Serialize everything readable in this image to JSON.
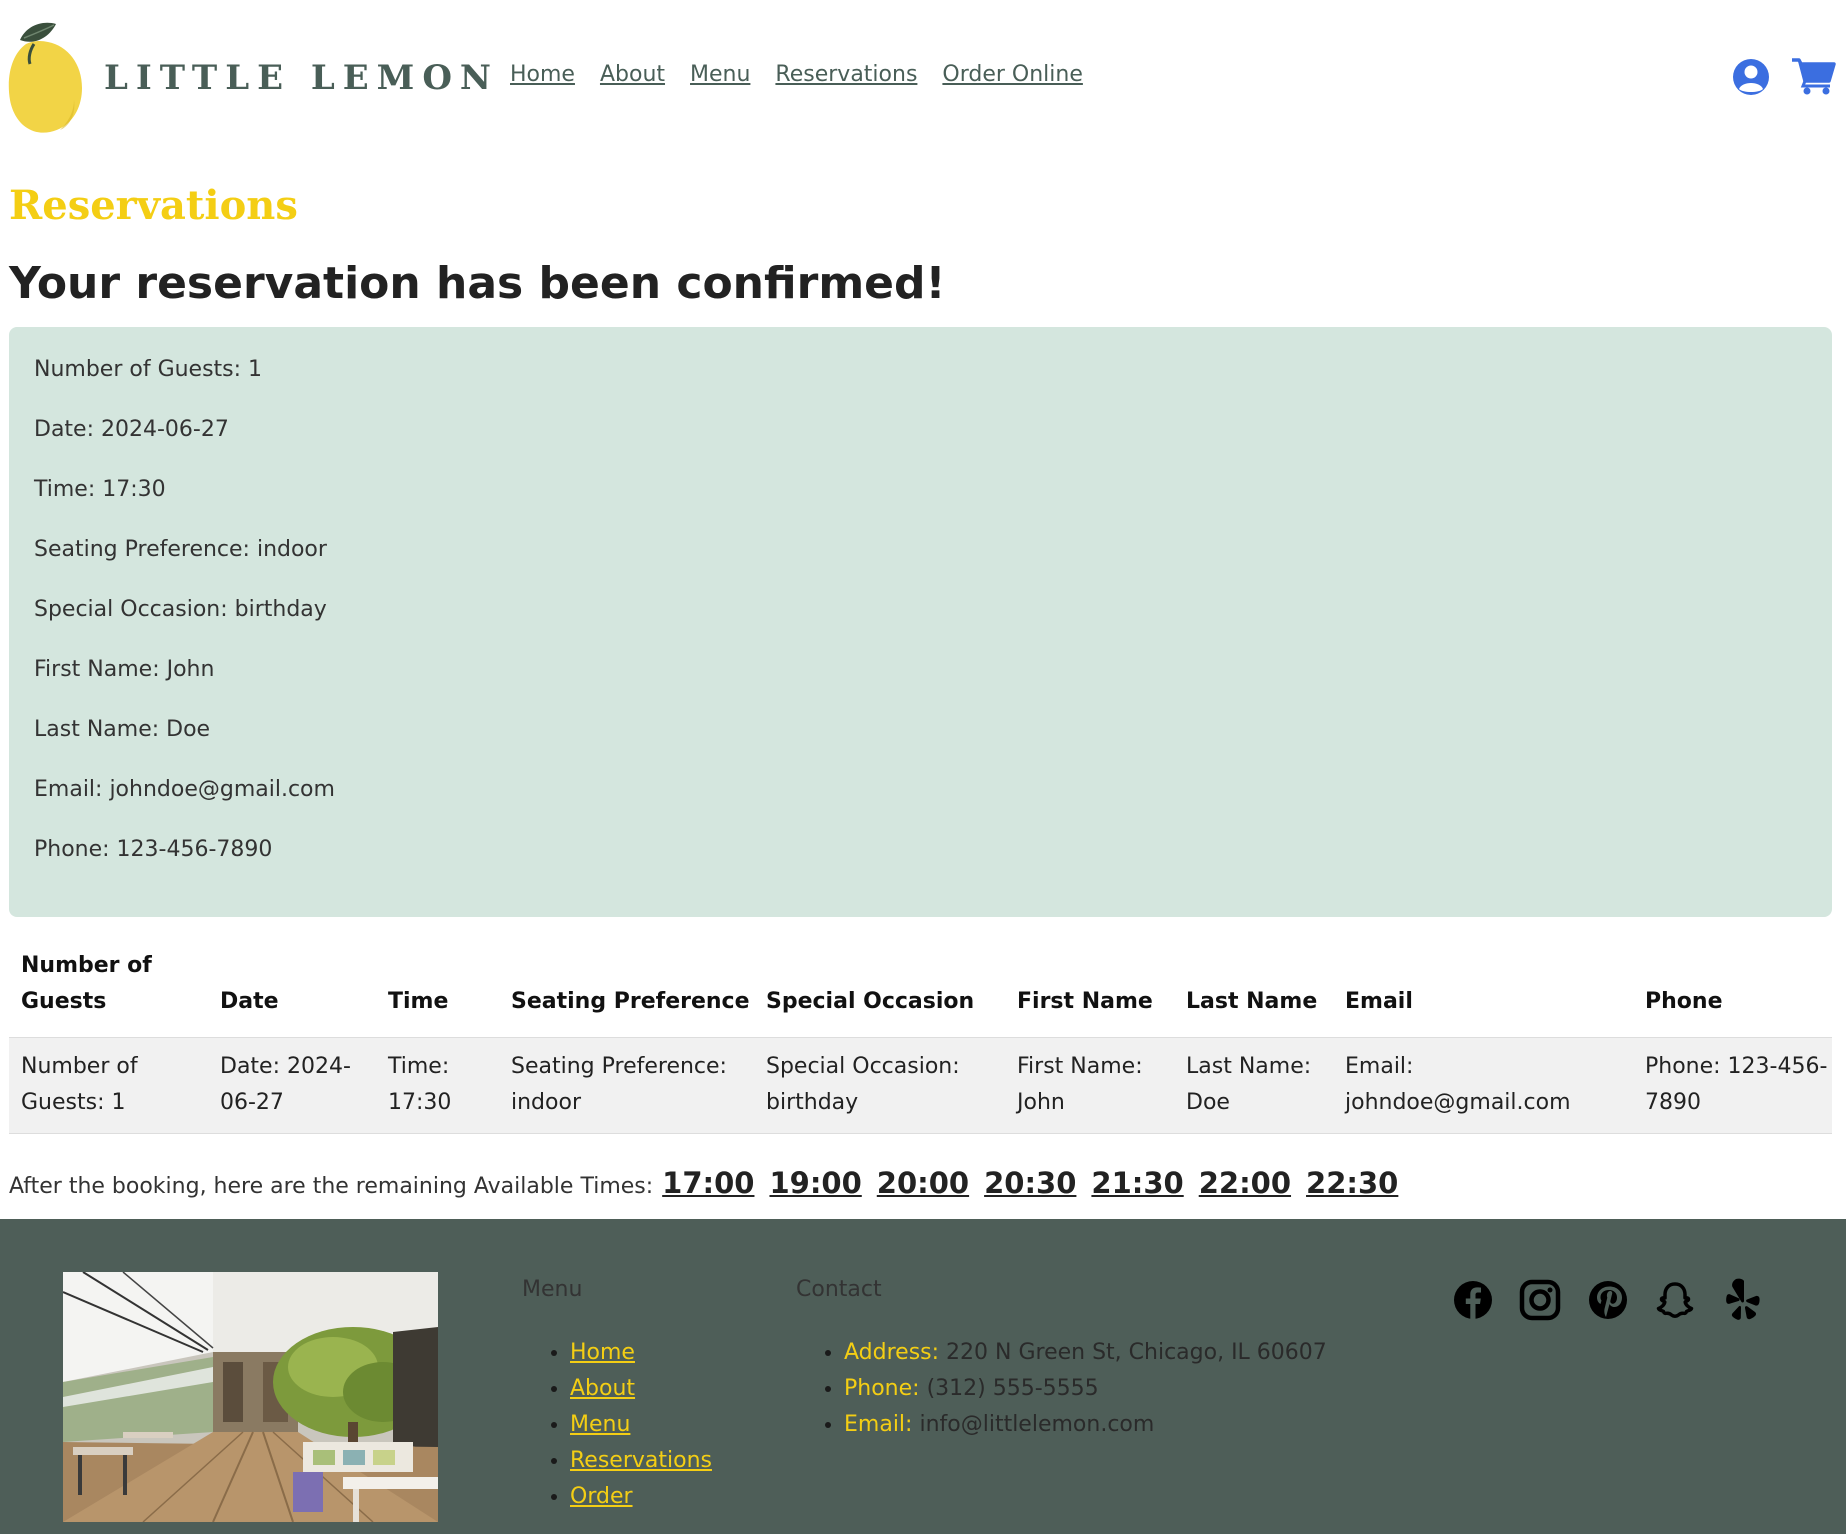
{
  "header": {
    "brand": "LITTLE LEMON",
    "nav": [
      "Home",
      "About",
      "Menu",
      "Reservations",
      "Order Online"
    ],
    "icons": [
      "user-icon",
      "cart-icon"
    ],
    "accent_color": "#3b6ee0"
  },
  "page": {
    "title": "Reservations",
    "confirmation_heading": "Your reservation has been confirmed!"
  },
  "confirmation": {
    "lines": [
      "Number of Guests: 1",
      "Date: 2024-06-27",
      "Time: 17:30",
      "Seating Preference: indoor",
      "Special Occasion: birthday",
      "First Name: John",
      "Last Name: Doe",
      "Email: johndoe@gmail.com",
      "Phone: 123-456-7890"
    ]
  },
  "table": {
    "headers": [
      "Number of Guests",
      "Date",
      "Time",
      "Seating Preference",
      "Special Occasion",
      "First Name",
      "Last Name",
      "Email",
      "Phone"
    ],
    "row": [
      "Number of Guests: 1",
      "Date: 2024-06-27",
      "Time: 17:30",
      "Seating Preference: indoor",
      "Special Occasion: birthday",
      "First Name: John",
      "Last Name: Doe",
      "Email: johndoe@gmail.com",
      "Phone: 123-456-7890"
    ]
  },
  "available": {
    "label": "After the booking, here are the remaining Available Times:",
    "times": [
      "17:00",
      "19:00",
      "20:00",
      "20:30",
      "21:30",
      "22:00",
      "22:30"
    ]
  },
  "footer": {
    "menu_heading": "Menu",
    "menu_links": [
      "Home",
      "About",
      "Menu",
      "Reservations",
      "Order"
    ],
    "contact_heading": "Contact",
    "contact": [
      {
        "label": "Address:",
        "value": "220 N Green St, Chicago, IL 60607"
      },
      {
        "label": "Phone:",
        "value": "(312) 555-5555"
      },
      {
        "label": "Email:",
        "value": "info@littlelemon.com"
      }
    ],
    "social_icons": [
      "facebook-icon",
      "instagram-icon",
      "pinterest-icon",
      "snapchat-icon",
      "yelp-icon"
    ],
    "background_color": "#4e5e58",
    "link_color": "#f4ce14"
  }
}
